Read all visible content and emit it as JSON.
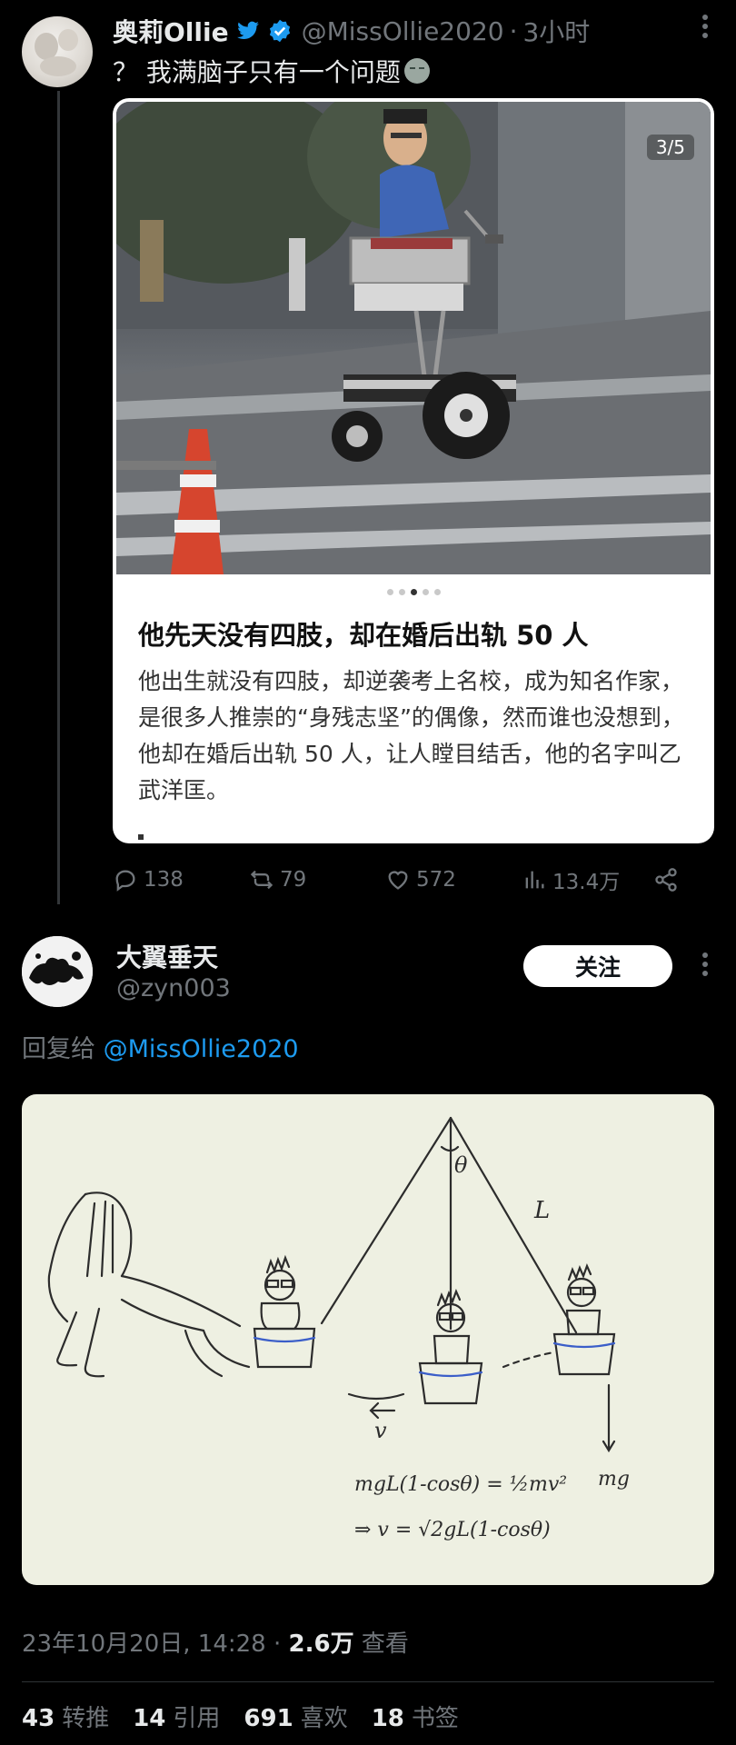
{
  "tweet": {
    "author_name": "奥莉Ollie",
    "author_handle": "@MissOllie2020",
    "separator": "·",
    "time": "3小时",
    "text": "？ 我满脑子只有一个问题",
    "card": {
      "image_counter": "3/5",
      "title": "他先天没有四肢，却在婚后出轨 50 人",
      "body": "他出生就没有四肢，却逆袭考上名校，成为知名作家，是很多人推崇的“身残志坚”的偶像，然而谁也没想到，他却在婚后出轨 50 人，让人瞠目结舌，他的名字叫乙武洋匡。",
      "carousel_count": 5,
      "carousel_active": 3
    },
    "actions": {
      "replies": "138",
      "retweets": "79",
      "likes": "572",
      "views": "13.4万"
    }
  },
  "reply": {
    "author_name": "大翼垂天",
    "author_handle": "@zyn003",
    "follow_label": "关注",
    "reply_to_prefix": "回复给",
    "reply_to_handle": "@MissOllie2020",
    "sketch_labels": {
      "theta": "θ",
      "length": "L",
      "velocity": "v",
      "force": "mg",
      "eq1": "mgL(1-cosθ) = ½mv²",
      "eq2": "⇒ v = √2gL(1-cosθ)"
    },
    "datetime": "23年10月20日, 14:28",
    "separator": "·",
    "views_count": "2.6万",
    "views_label": "查看",
    "stats": {
      "retweets_count": "43",
      "retweets_label": "转推",
      "quotes_count": "14",
      "quotes_label": "引用",
      "likes_count": "691",
      "likes_label": "喜欢",
      "bookmarks_count": "18",
      "bookmarks_label": "书签"
    }
  },
  "colors": {
    "background": "#000000",
    "secondary_text": "#71767b",
    "link": "#1d9bf0",
    "verified": "#1d9bf0"
  },
  "icons": [
    "twitter-bird-icon",
    "verified-badge-icon",
    "more-icon",
    "reply-icon",
    "retweet-icon",
    "like-icon",
    "views-icon",
    "share-icon"
  ]
}
